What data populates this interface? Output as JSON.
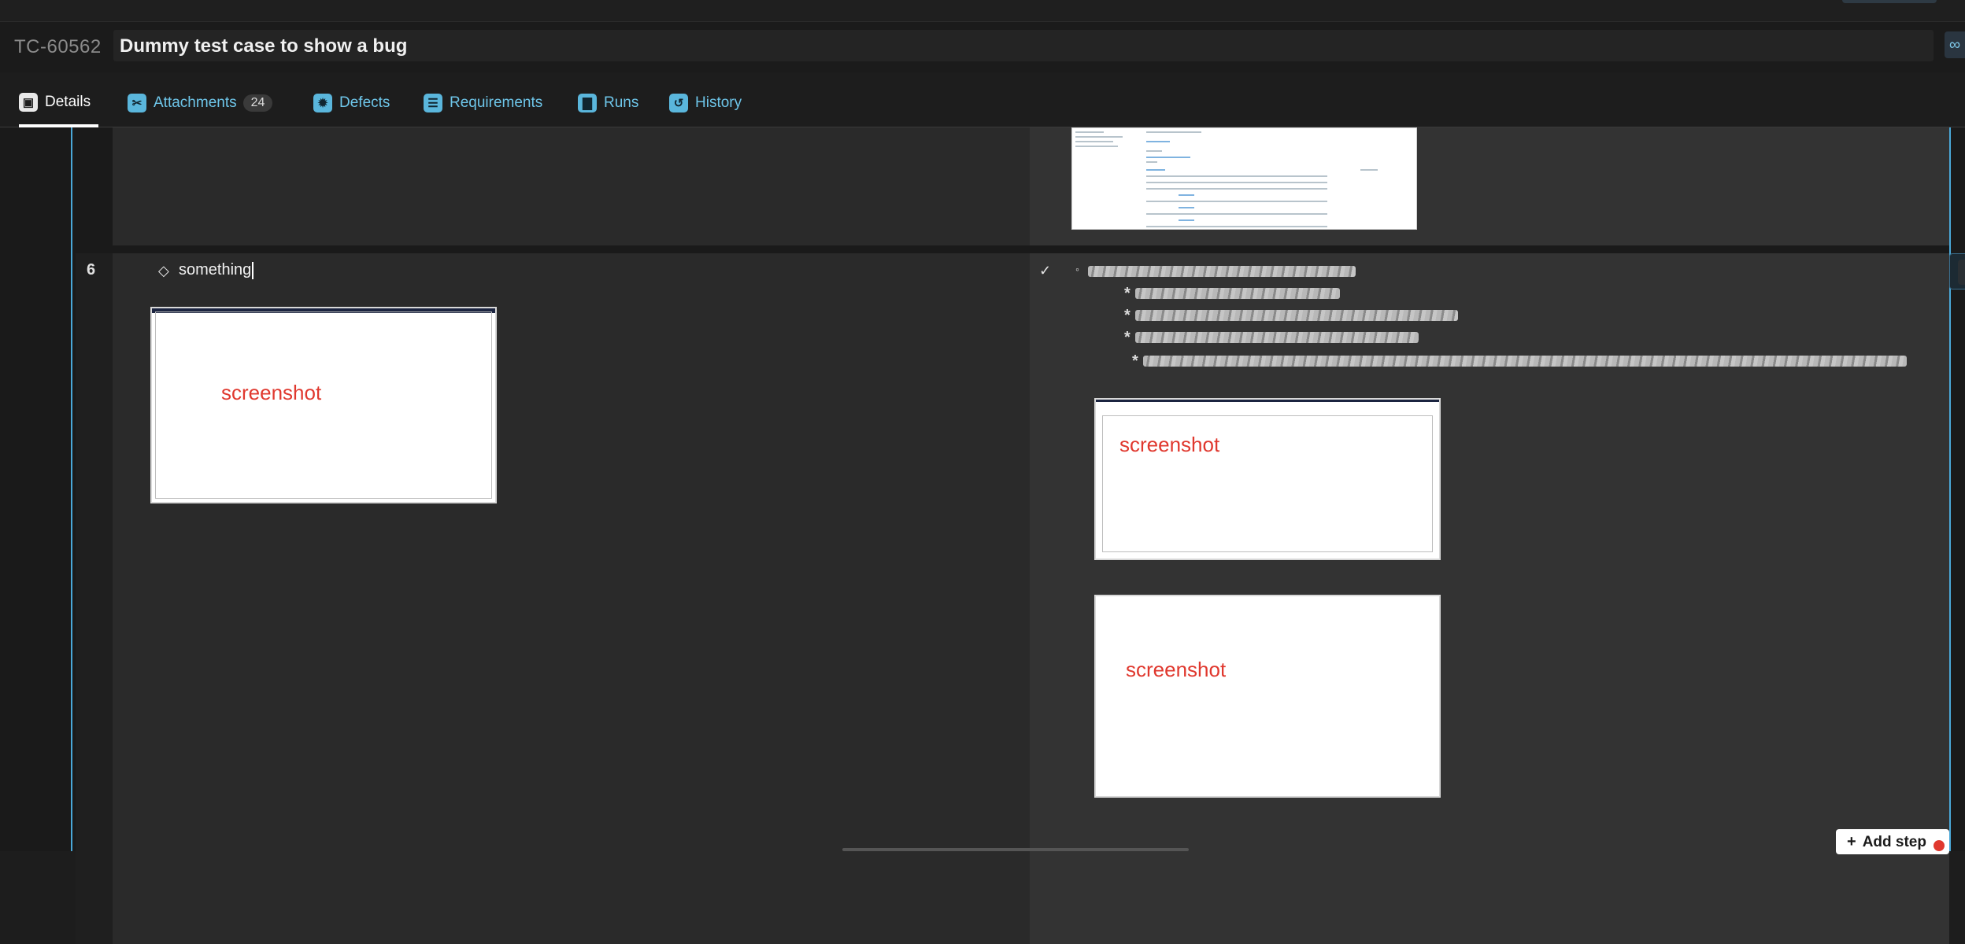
{
  "header": {
    "case_id": "TC-60562",
    "case_title": "Dummy test case to show a bug",
    "link_icon": "link-icon"
  },
  "tabs": [
    {
      "label": "Details",
      "icon": "details-icon",
      "active": true
    },
    {
      "label": "Attachments",
      "icon": "paperclip-icon",
      "badge": "24"
    },
    {
      "label": "Defects",
      "icon": "bug-icon"
    },
    {
      "label": "Requirements",
      "icon": "document-icon"
    },
    {
      "label": "Runs",
      "icon": "bar-chart-icon"
    },
    {
      "label": "History",
      "icon": "history-icon"
    }
  ],
  "step": {
    "number": "6",
    "action_text": "something",
    "action_icon": "step-action-icon",
    "expected_icon": "check-circle-icon",
    "bullet": "*",
    "small_bullet": "◦",
    "screenshots": {
      "action": "screenshot",
      "expected_1": "screenshot",
      "expected_2": "screenshot"
    }
  },
  "row_actions": {
    "add": "+",
    "more": "⋯"
  },
  "footer": {
    "add_step_label": "Add step"
  },
  "colors": {
    "accent": "#4aa8d8",
    "tab_link": "#6ec6ea",
    "screenshot_label": "#e0382e"
  }
}
